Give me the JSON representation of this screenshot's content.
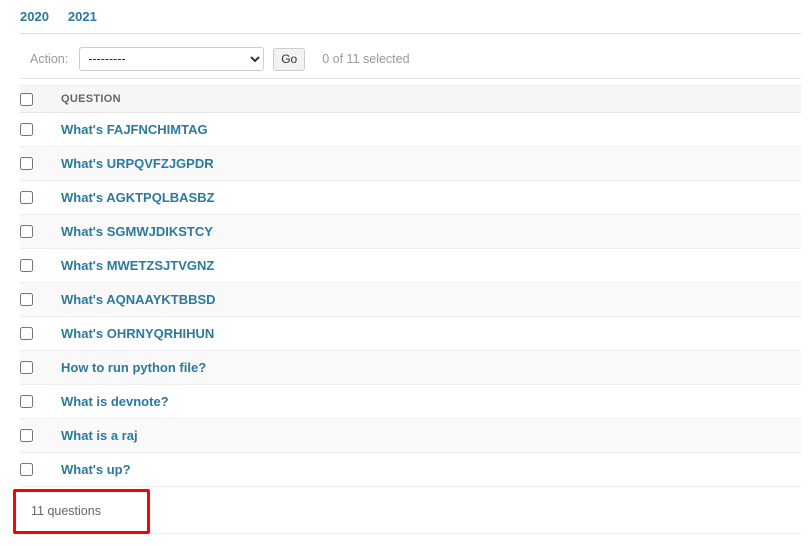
{
  "tabs": {
    "items": [
      {
        "label": "2020"
      },
      {
        "label": "2021"
      }
    ]
  },
  "actions": {
    "label": "Action:",
    "select_value": "---------",
    "options": [
      "---------"
    ],
    "go_label": "Go",
    "selection_status": "0 of 11 selected"
  },
  "table": {
    "columns": [
      {
        "label": ""
      },
      {
        "label": "QUESTION"
      }
    ],
    "rows": [
      {
        "question": "What's FAJFNCHIMTAG"
      },
      {
        "question": "What's URPQVFZJGPDR"
      },
      {
        "question": "What's AGKTPQLBASBZ"
      },
      {
        "question": "What's SGMWJDIKSTCY"
      },
      {
        "question": "What's MWETZSJTVGNZ"
      },
      {
        "question": "What's AQNAAYKTBBSD"
      },
      {
        "question": "What's OHRNYQRHIHUN"
      },
      {
        "question": "How to run python file?"
      },
      {
        "question": "What is devnote?"
      },
      {
        "question": "What is a raj"
      },
      {
        "question": "What's up?"
      }
    ]
  },
  "paginator": {
    "count_label": "11 questions"
  },
  "annotation": {
    "highlight_color": "#ff0000"
  },
  "theme": {
    "link_color": "#2b7a9e",
    "header_text": "#666666",
    "muted_text": "#999999",
    "row_stripe": "#f9f9f9",
    "header_bg": "#f6f6f6"
  }
}
